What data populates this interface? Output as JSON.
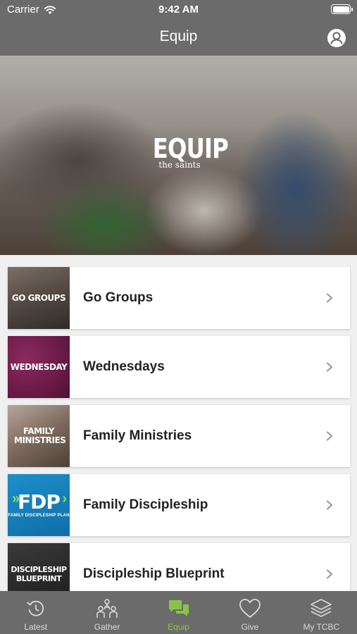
{
  "status_bar": {
    "carrier": "Carrier",
    "time": "9:42 AM"
  },
  "nav": {
    "title": "Equip"
  },
  "hero": {
    "wordmark": "EQUIP",
    "tagline": "the saints"
  },
  "items": [
    {
      "title": "Go Groups",
      "thumb_label": "GO GROUPS"
    },
    {
      "title": "Wednesdays",
      "thumb_label": "WEDNESDAY"
    },
    {
      "title": "Family Ministries",
      "thumb_label": "FAMILY MINISTRIES"
    },
    {
      "title": "Family Discipleship",
      "thumb_label": "FDP",
      "thumb_sublabel": "FAMILY DISCIPLESHIP PLAN"
    },
    {
      "title": "Discipleship Blueprint",
      "thumb_label": "DISCIPLESHIP BLUEPRINT"
    }
  ],
  "tabs": [
    {
      "label": "Latest",
      "icon": "history-icon"
    },
    {
      "label": "Gather",
      "icon": "people-icon"
    },
    {
      "label": "Equip",
      "icon": "chat-bubbles-icon",
      "active": true
    },
    {
      "label": "Give",
      "icon": "heart-icon"
    },
    {
      "label": "My TCBC",
      "icon": "layers-icon"
    }
  ],
  "colors": {
    "bar": "#6b6b6b",
    "accent": "#8bc34a",
    "fdp_blue": "#1e8ec9",
    "wednesday": "#6b1a47"
  }
}
